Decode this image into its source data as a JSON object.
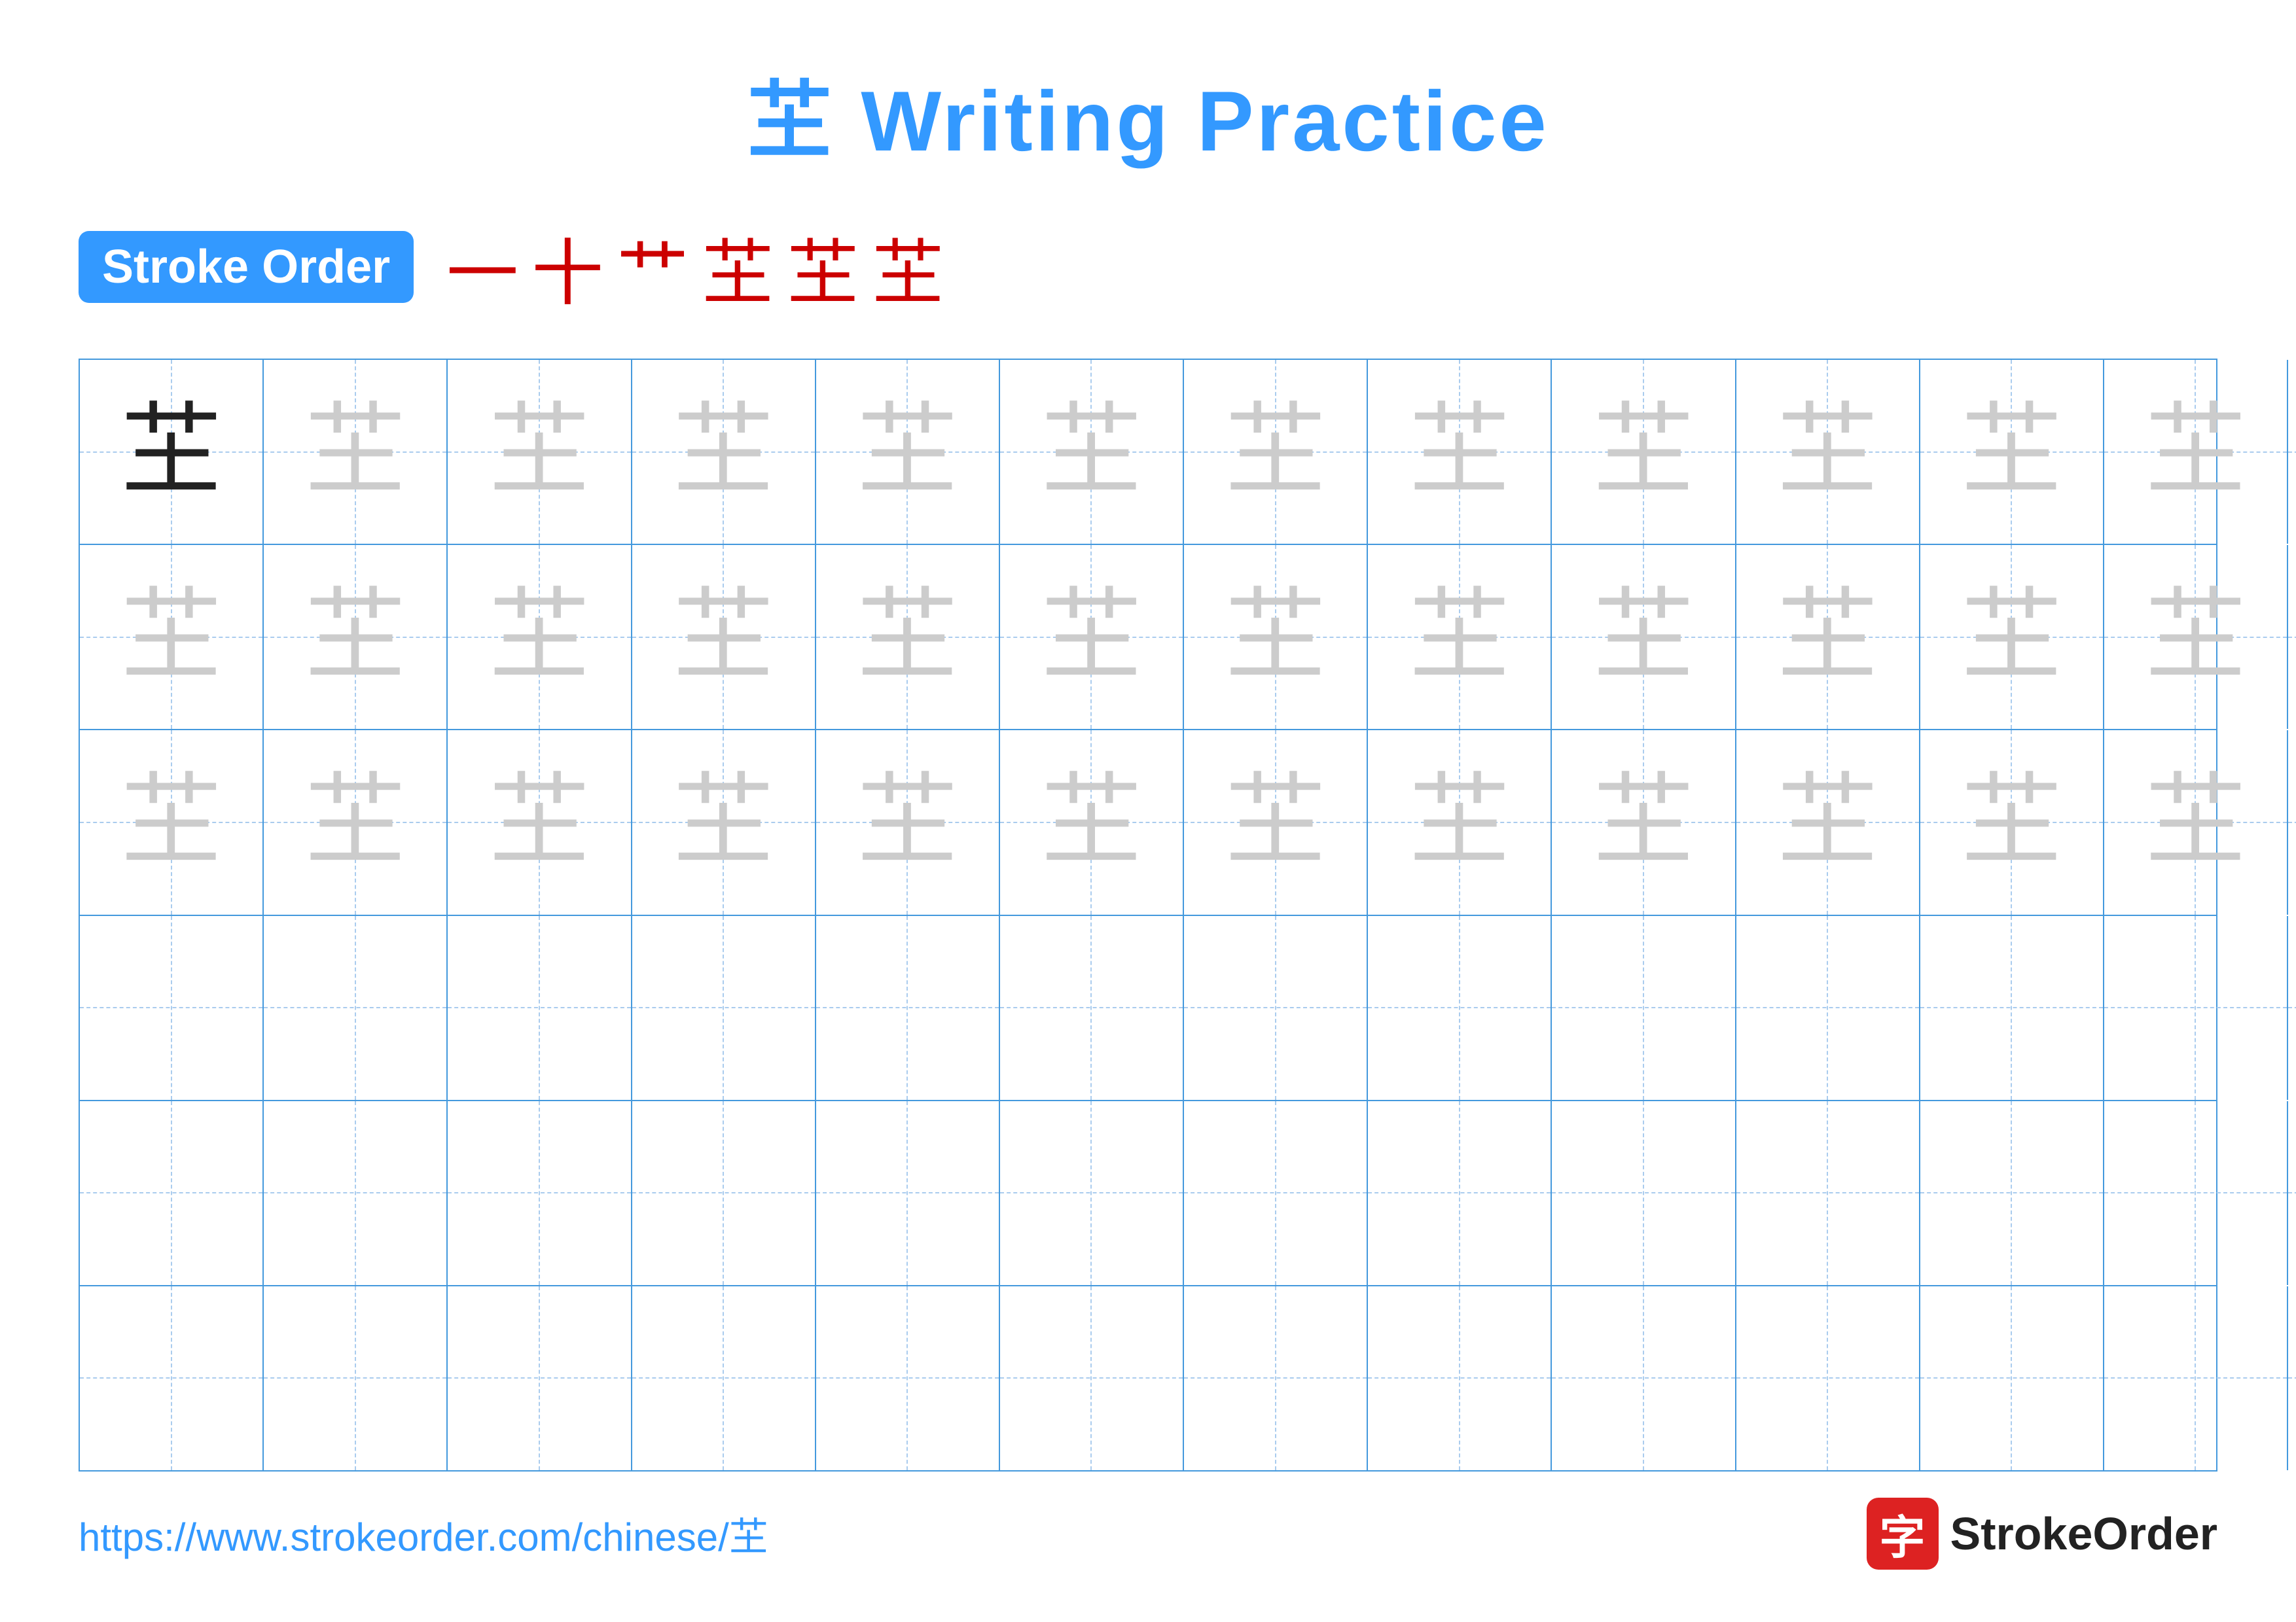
{
  "title": {
    "char": "芏",
    "label": "Writing Practice",
    "full": "芏 Writing Practice"
  },
  "stroke_order": {
    "badge_label": "Stroke Order",
    "strokes": [
      "一",
      "十",
      "艹",
      "芏",
      "芏",
      "芏"
    ]
  },
  "grid": {
    "rows": 6,
    "cols": 13,
    "char": "芏",
    "filled_rows": 3,
    "empty_rows": 3
  },
  "footer": {
    "url": "https://www.strokeorder.com/chinese/芏",
    "logo_char": "字",
    "logo_label": "StrokeOrder"
  }
}
